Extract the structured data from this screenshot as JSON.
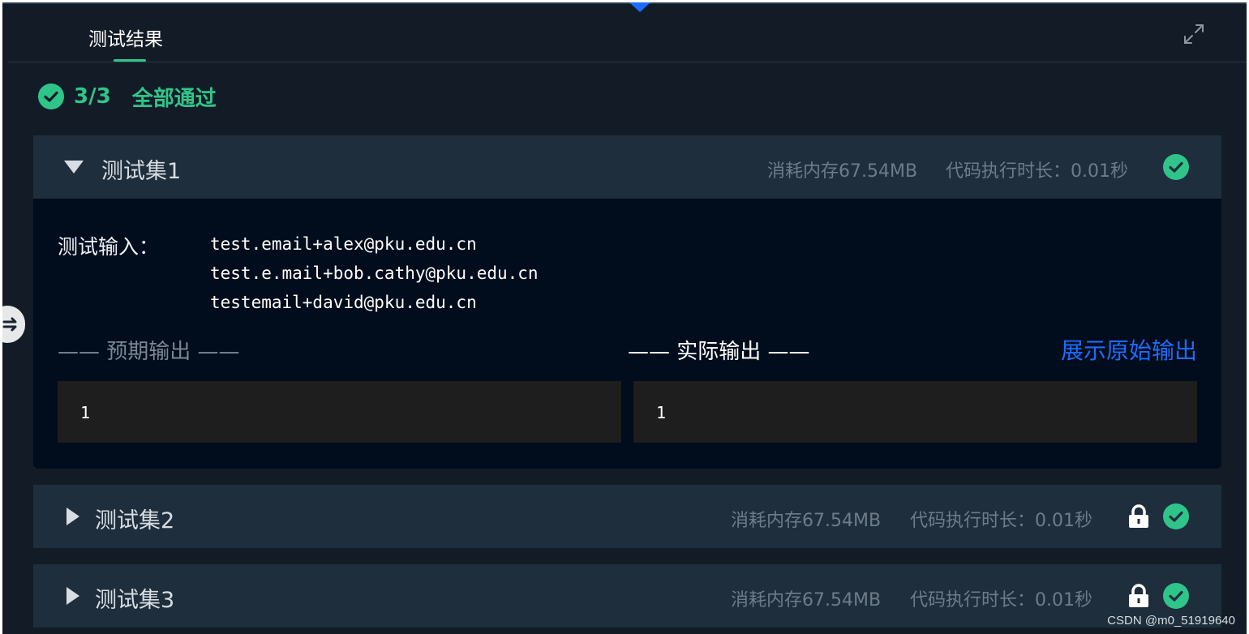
{
  "header": {
    "tab_label": "测试结果"
  },
  "summary": {
    "count": "3/3",
    "status": "全部通过"
  },
  "test_sets": [
    {
      "title": "测试集1",
      "memory": "消耗内存67.54MB",
      "duration": "代码执行时长：0.01秒",
      "expanded": true,
      "locked": false
    },
    {
      "title": "测试集2",
      "memory": "消耗内存67.54MB",
      "duration": "代码执行时长：0.01秒",
      "expanded": false,
      "locked": true
    },
    {
      "title": "测试集3",
      "memory": "消耗内存67.54MB",
      "duration": "代码执行时长：0.01秒",
      "expanded": false,
      "locked": true
    }
  ],
  "detail": {
    "input_label": "测试输入：",
    "input_lines": [
      "test.email+alex@pku.edu.cn",
      "test.e.mail+bob.cathy@pku.edu.cn",
      "testemail+david@pku.edu.cn"
    ],
    "expected_label": "—— 预期输出 ——",
    "actual_label": "—— 实际输出 ——",
    "show_raw_label": "展示原始输出",
    "expected_output": "1",
    "actual_output": "1"
  },
  "watermark": "CSDN @m0_51919640",
  "colors": {
    "accent_green": "#2fc58a",
    "link_blue": "#1a6dff",
    "panel_bg": "#131c26"
  }
}
